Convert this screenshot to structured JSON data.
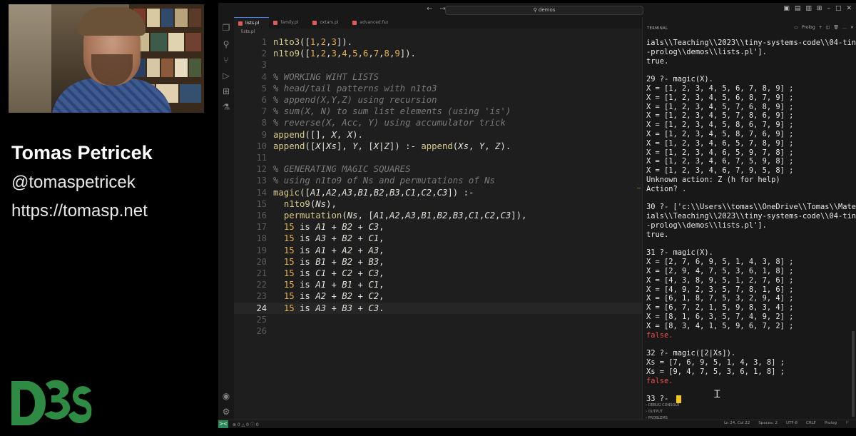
{
  "presenter": {
    "name": "Tomas Petricek",
    "handle": "@tomaspetricek",
    "url": "https://tomasp.net",
    "logo_text": "D3S"
  },
  "window": {
    "search": "demos",
    "nav_back": "←",
    "nav_forward": "→"
  },
  "editor": {
    "tabs": [
      {
        "label": "lists.pl",
        "active": true
      },
      {
        "label": "family.pl",
        "active": false
      },
      {
        "label": "oxtars.pl",
        "active": false
      },
      {
        "label": "advanced.fsx",
        "active": false
      }
    ],
    "breadcrumb": "lists.pl",
    "current_line": 24,
    "lines": [
      {
        "n": "1",
        "text": "n1to3([1,2,3])."
      },
      {
        "n": "2",
        "text": "n1to9([1,2,3,4,5,6,7,8,9])."
      },
      {
        "n": "3",
        "text": ""
      },
      {
        "n": "4",
        "text": "% WORKING WIHT LISTS"
      },
      {
        "n": "5",
        "text": "% head/tail patterns with n1to3"
      },
      {
        "n": "6",
        "text": "% append(X,Y,Z) using recursion"
      },
      {
        "n": "7",
        "text": "% sum(X, N) to sum list elements (using 'is')"
      },
      {
        "n": "8",
        "text": "% reverse(X, Acc, Y) using accumulator trick"
      },
      {
        "n": "9",
        "text": "append([], X, X)."
      },
      {
        "n": "10",
        "text": "append([X|Xs], Y, [X|Z]) :- append(Xs, Y, Z)."
      },
      {
        "n": "11",
        "text": ""
      },
      {
        "n": "12",
        "text": "% GENERATING MAGIC SQUARES"
      },
      {
        "n": "13",
        "text": "% using n1to9 of Ns and permutations of Ns"
      },
      {
        "n": "14",
        "text": "magic([A1,A2,A3,B1,B2,B3,C1,C2,C3]) :-"
      },
      {
        "n": "15",
        "text": "  n1to9(Ns),"
      },
      {
        "n": "16",
        "text": "  permutation(Ns, [A1,A2,A3,B1,B2,B3,C1,C2,C3]),"
      },
      {
        "n": "17",
        "text": "  15 is A1 + B2 + C3,"
      },
      {
        "n": "18",
        "text": "  15 is A3 + B2 + C1,"
      },
      {
        "n": "19",
        "text": "  15 is A1 + A2 + A3,"
      },
      {
        "n": "20",
        "text": "  15 is B1 + B2 + B3,"
      },
      {
        "n": "21",
        "text": "  15 is C1 + C2 + C3,"
      },
      {
        "n": "22",
        "text": "  15 is A1 + B1 + C1,"
      },
      {
        "n": "23",
        "text": "  15 is A2 + B2 + C2,"
      },
      {
        "n": "24",
        "text": "  15 is A3 + B3 + C3."
      },
      {
        "n": "25",
        "text": ""
      },
      {
        "n": "26",
        "text": ""
      }
    ]
  },
  "panel": {
    "title": "TERMINAL",
    "shell_label": "Prolog",
    "lines": [
      {
        "text": "ials\\\\Teaching\\\\2023\\\\tiny-systems-code\\\\04-tiny",
        "kind": "out"
      },
      {
        "text": "-prolog\\\\demos\\\\lists.pl'].",
        "kind": "out"
      },
      {
        "text": "true.",
        "kind": "out"
      },
      {
        "text": "",
        "kind": "out"
      },
      {
        "text": "29 ?- magic(X).",
        "kind": "out"
      },
      {
        "text": "X = [1, 2, 3, 4, 5, 6, 7, 8, 9] ;",
        "kind": "out"
      },
      {
        "text": "X = [1, 2, 3, 4, 5, 6, 8, 7, 9] ;",
        "kind": "out"
      },
      {
        "text": "X = [1, 2, 3, 4, 5, 7, 6, 8, 9] ;",
        "kind": "out"
      },
      {
        "text": "X = [1, 2, 3, 4, 5, 7, 8, 6, 9] ;",
        "kind": "out"
      },
      {
        "text": "X = [1, 2, 3, 4, 5, 8, 6, 7, 9] ;",
        "kind": "out"
      },
      {
        "text": "X = [1, 2, 3, 4, 5, 8, 7, 6, 9] ;",
        "kind": "out"
      },
      {
        "text": "X = [1, 2, 3, 4, 6, 5, 7, 8, 9] ;",
        "kind": "out"
      },
      {
        "text": "X = [1, 2, 3, 4, 6, 5, 9, 7, 8] ;",
        "kind": "out"
      },
      {
        "text": "X = [1, 2, 3, 4, 6, 7, 5, 9, 8] ;",
        "kind": "out"
      },
      {
        "text": "X = [1, 2, 3, 4, 6, 7, 9, 5, 8] ;",
        "kind": "out"
      },
      {
        "text": "Unknown action: Z (h for help)",
        "kind": "out"
      },
      {
        "text": "Action? .",
        "kind": "out",
        "marker": true
      },
      {
        "text": "",
        "kind": "out"
      },
      {
        "text": "30 ?- ['c:\\\\Users\\\\tomas\\\\OneDrive\\\\Tomas\\\\Mater",
        "kind": "out"
      },
      {
        "text": "ials\\\\Teaching\\\\2023\\\\tiny-systems-code\\\\04-tiny",
        "kind": "out"
      },
      {
        "text": "-prolog\\\\demos\\\\lists.pl'].",
        "kind": "out"
      },
      {
        "text": "true.",
        "kind": "out"
      },
      {
        "text": "",
        "kind": "out"
      },
      {
        "text": "31 ?- magic(X).",
        "kind": "out"
      },
      {
        "text": "X = [2, 7, 6, 9, 5, 1, 4, 3, 8] ;",
        "kind": "out"
      },
      {
        "text": "X = [2, 9, 4, 7, 5, 3, 6, 1, 8] ;",
        "kind": "out"
      },
      {
        "text": "X = [4, 3, 8, 9, 5, 1, 2, 7, 6] ;",
        "kind": "out"
      },
      {
        "text": "X = [4, 9, 2, 3, 5, 7, 8, 1, 6] ;",
        "kind": "out"
      },
      {
        "text": "X = [6, 1, 8, 7, 5, 3, 2, 9, 4] ;",
        "kind": "out"
      },
      {
        "text": "X = [6, 7, 2, 1, 5, 9, 8, 3, 4] ;",
        "kind": "out"
      },
      {
        "text": "X = [8, 1, 6, 3, 5, 7, 4, 9, 2] ;",
        "kind": "out"
      },
      {
        "text": "X = [8, 3, 4, 1, 5, 9, 6, 7, 2] ;",
        "kind": "out"
      },
      {
        "text": "false.",
        "kind": "err"
      },
      {
        "text": "",
        "kind": "out"
      },
      {
        "text": "32 ?- magic([2|Xs]).",
        "kind": "out"
      },
      {
        "text": "Xs = [7, 6, 9, 5, 1, 4, 3, 8] ;",
        "kind": "out"
      },
      {
        "text": "Xs = [9, 4, 7, 5, 3, 6, 1, 8] ;",
        "kind": "out"
      },
      {
        "text": "false.",
        "kind": "err"
      },
      {
        "text": "",
        "kind": "out"
      },
      {
        "text": "33 ?- ",
        "kind": "prompt"
      }
    ],
    "sections": [
      "DEBUG CONSOLE",
      "OUTPUT",
      "PROBLEMS"
    ]
  },
  "statusbar": {
    "remote": "><",
    "left": "⊗ 0 △ 0    ⓘ 0",
    "right": [
      "Ln 24, Col 22",
      "Spaces: 2",
      "UTF-8",
      "CRLF",
      "Prolog",
      "⚐"
    ]
  },
  "icons": {
    "activity": [
      "files-icon",
      "search-icon",
      "source-control-icon",
      "run-debug-icon",
      "extensions-icon",
      "testing-icon",
      "account-icon",
      "settings-icon"
    ]
  },
  "colors": {
    "editor_bg": "#1e1e1e",
    "comment": "#7a7a7a",
    "number": "#e6b24a",
    "error": "#f14c4c",
    "cursor": "#f5c518",
    "logo": "#2e8b43"
  }
}
